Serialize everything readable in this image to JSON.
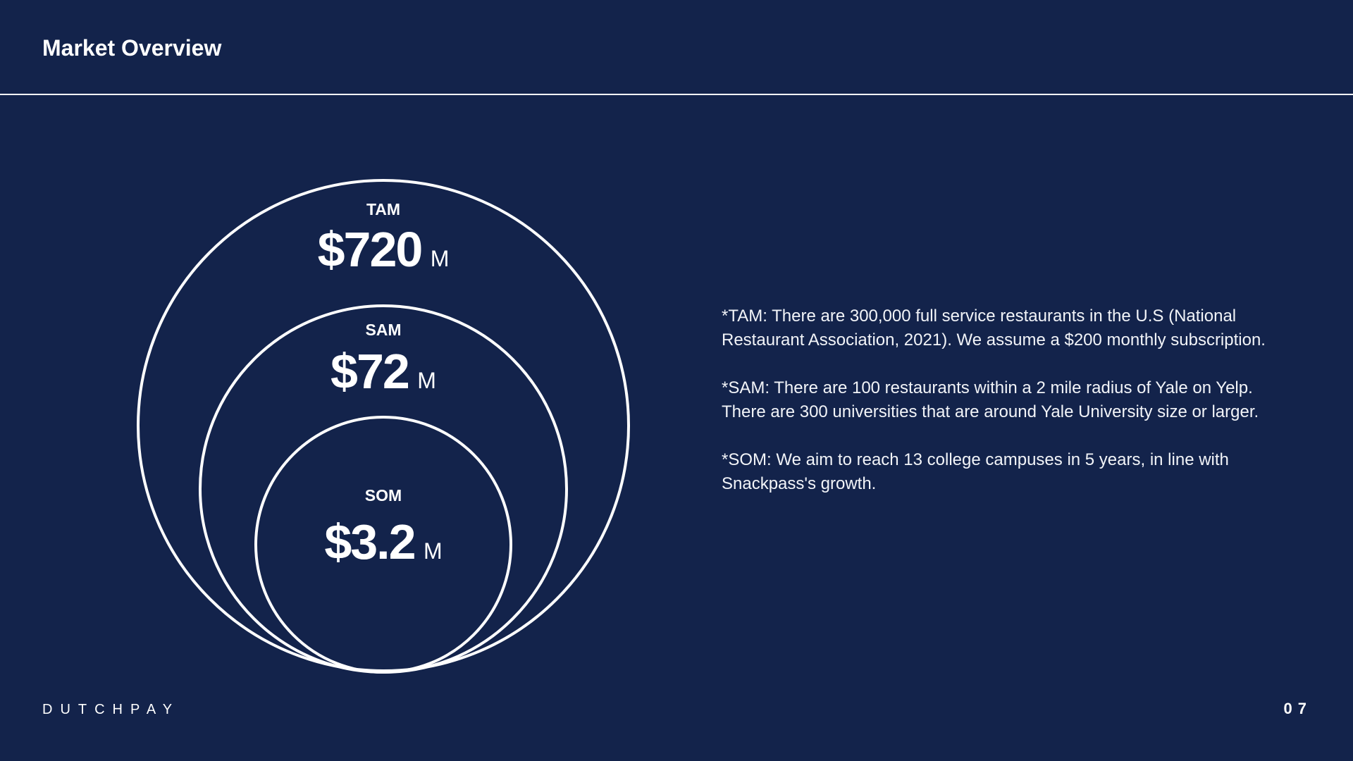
{
  "slide": {
    "title": "Market Overview"
  },
  "diagram": {
    "tam": {
      "label": "TAM",
      "value": "$720",
      "unit": "M"
    },
    "sam": {
      "label": "SAM",
      "value": "$72",
      "unit": "M"
    },
    "som": {
      "label": "SOM",
      "value": "$3.2",
      "unit": "M"
    }
  },
  "notes": {
    "tam": "*TAM: There are 300,000 full service restaurants in the U.S (National Restaurant Association, 2021). We assume a $200 monthly subscription.",
    "sam": "*SAM: There are 100 restaurants within a 2 mile radius of Yale on Yelp. There are 300 universities that are around Yale University size or larger.",
    "som": "*SOM: We aim to reach 13 college campuses in 5 years, in line with Snackpass's growth."
  },
  "footer": {
    "brand": "DUTCHPAY",
    "page_number": "07"
  },
  "colors": {
    "background": "#13234b",
    "foreground": "#ffffff"
  }
}
